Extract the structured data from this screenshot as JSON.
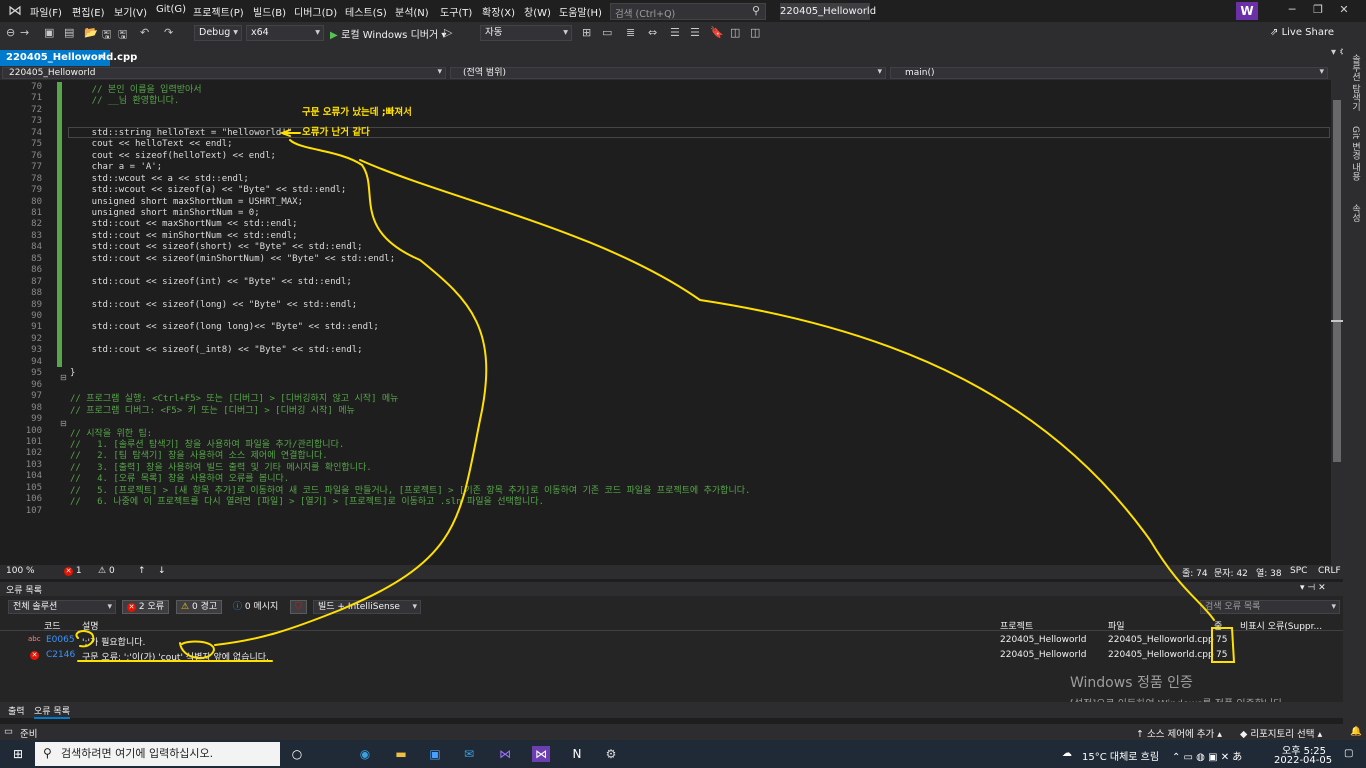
{
  "menu": [
    "파일(F)",
    "편집(E)",
    "보기(V)",
    "Git(G)",
    "프로젝트(P)",
    "빌드(B)",
    "디버그(D)",
    "테스트(S)",
    "분석(N)",
    "도구(T)",
    "확장(X)",
    "창(W)",
    "도움말(H)"
  ],
  "search": {
    "placeholder": "검색 (Ctrl+Q)"
  },
  "solution_name": "220405_Helloworld",
  "user_initial": "W",
  "toolbar": {
    "config": "Debug",
    "platform": "x64",
    "run_label": "로컬 Windows 디버거",
    "mode": "자동",
    "live_share": "Live Share"
  },
  "doc_tab": {
    "name": "220405_Helloworld.cpp",
    "close": "×"
  },
  "navbar": {
    "project": "220405_Helloworld",
    "scope": "(전역 범위)",
    "function": "main()"
  },
  "right_strip": [
    "솔루션 탐색기",
    "Git 변경 내용",
    "속성"
  ],
  "code": [
    {
      "n": "70",
      "t": "    // 본인 이름을 입력받아서",
      "k": "com"
    },
    {
      "n": "71",
      "t": "    // __님 환영합니다.",
      "k": "com"
    },
    {
      "n": "72",
      "t": "",
      "k": "txt"
    },
    {
      "n": "73",
      "t": "",
      "k": "txt"
    },
    {
      "n": "74",
      "t": "    std::string helloText = \"helloworld!\"",
      "k": "txt"
    },
    {
      "n": "75",
      "t": "    cout << helloText << endl;",
      "k": "txt"
    },
    {
      "n": "76",
      "t": "    cout << sizeof(helloText) << endl;",
      "k": "txt"
    },
    {
      "n": "77",
      "t": "    char a = 'A';",
      "k": "txt"
    },
    {
      "n": "78",
      "t": "    std::wcout << a << std::endl;",
      "k": "txt"
    },
    {
      "n": "79",
      "t": "    std::wcout << sizeof(a) << \"Byte\" << std::endl;",
      "k": "txt"
    },
    {
      "n": "80",
      "t": "    unsigned short maxShortNum = USHRT_MAX;",
      "k": "txt"
    },
    {
      "n": "81",
      "t": "    unsigned short minShortNum = 0;",
      "k": "txt"
    },
    {
      "n": "82",
      "t": "    std::cout << maxShortNum << std::endl;",
      "k": "txt"
    },
    {
      "n": "83",
      "t": "    std::cout << minShortNum << std::endl;",
      "k": "txt"
    },
    {
      "n": "84",
      "t": "    std::cout << sizeof(short) << \"Byte\" << std::endl;",
      "k": "txt"
    },
    {
      "n": "85",
      "t": "    std::cout << sizeof(minShortNum) << \"Byte\" << std::endl;",
      "k": "txt"
    },
    {
      "n": "86",
      "t": "",
      "k": "txt"
    },
    {
      "n": "87",
      "t": "    std::cout << sizeof(int) << \"Byte\" << std::endl;",
      "k": "txt"
    },
    {
      "n": "88",
      "t": "",
      "k": "txt"
    },
    {
      "n": "89",
      "t": "    std::cout << sizeof(long) << \"Byte\" << std::endl;",
      "k": "txt"
    },
    {
      "n": "90",
      "t": "",
      "k": "txt"
    },
    {
      "n": "91",
      "t": "    std::cout << sizeof(long long)<< \"Byte\" << std::endl;",
      "k": "txt"
    },
    {
      "n": "92",
      "t": "",
      "k": "txt"
    },
    {
      "n": "93",
      "t": "    std::cout << sizeof(_int8) << \"Byte\" << std::endl;",
      "k": "txt"
    },
    {
      "n": "94",
      "t": "",
      "k": "txt"
    },
    {
      "n": "95",
      "t": "}",
      "k": "txt"
    },
    {
      "n": "96",
      "t": "",
      "k": "txt"
    },
    {
      "n": "97",
      "t": "// 프로그램 실행: <Ctrl+F5> 또는 [디버그] > [디버깅하지 않고 시작] 메뉴",
      "k": "com"
    },
    {
      "n": "98",
      "t": "// 프로그램 디버그: <F5> 키 또는 [디버그] > [디버깅 시작] 메뉴",
      "k": "com"
    },
    {
      "n": "99",
      "t": "",
      "k": "txt"
    },
    {
      "n": "100",
      "t": "// 시작을 위한 팁:",
      "k": "com"
    },
    {
      "n": "101",
      "t": "//   1. [솔루션 탐색기] 창을 사용하여 파일을 추가/관리합니다.",
      "k": "com"
    },
    {
      "n": "102",
      "t": "//   2. [팀 탐색기] 창을 사용하여 소스 제어에 연결합니다.",
      "k": "com"
    },
    {
      "n": "103",
      "t": "//   3. [출력] 창을 사용하여 빌드 출력 및 기타 메시지를 확인합니다.",
      "k": "com"
    },
    {
      "n": "104",
      "t": "//   4. [오류 목록] 창을 사용하여 오류를 봅니다.",
      "k": "com"
    },
    {
      "n": "105",
      "t": "//   5. [프로젝트] > [새 항목 추가]로 이동하여 새 코드 파일을 만들거나, [프로젝트] > [기존 항목 추가]로 이동하여 기존 코드 파일을 프로젝트에 추가합니다.",
      "k": "com"
    },
    {
      "n": "106",
      "t": "//   6. 나중에 이 프로젝트를 다시 열려면 [파일] > [열기] > [프로젝트]로 이동하고 .sln 파일을 선택합니다.",
      "k": "com"
    },
    {
      "n": "107",
      "t": "",
      "k": "txt"
    }
  ],
  "editor_status": {
    "zoom": "100 %",
    "errors": "1",
    "warnings": "0",
    "line": "줄: 74",
    "char": "문자: 42",
    "col": "열: 38",
    "spc": "SPC",
    "crlf": "CRLF"
  },
  "error_list": {
    "title": "오류 목록",
    "scope": "전체 솔루션",
    "errors_btn": "2 오류",
    "warnings_btn": "0 경고",
    "messages_btn": "0 메시지",
    "build_filter": "빌드 + IntelliSense",
    "search_placeholder": "검색 오류 목록",
    "headers": {
      "code": "코드",
      "desc": "설명",
      "project": "프로젝트",
      "file": "파일",
      "line": "줄",
      "suppress": "비표시 오류(Suppr..."
    },
    "rows": [
      {
        "icon": "abc",
        "code": "E0065",
        "desc": "';'가 필요합니다.",
        "project": "220405_Helloworld",
        "file": "220405_Helloworld.cpp",
        "line": "75"
      },
      {
        "icon": "x",
        "code": "C2146",
        "desc": "구문 오류: ';'이(가) 'cout' 식별자 앞에 없습니다.",
        "project": "220405_Helloworld",
        "file": "220405_Helloworld.cpp",
        "line": "75"
      }
    ]
  },
  "activation": {
    "title": "Windows 정품 인증",
    "subtitle": "[설정]으로 이동하여 Windows를 정품 인증합니다."
  },
  "bottom_tabs": [
    "출력",
    "오류 목록"
  ],
  "statusbar": {
    "ready": "준비",
    "source_control": "소스 제어에 추가",
    "repo": "리포지토리 선택"
  },
  "taskbar": {
    "search_placeholder": "검색하려면 여기에 입력하십시오.",
    "weather": "15°C 대체로 흐림",
    "time": "오후 5:25",
    "date": "2022-04-05"
  },
  "annotation": {
    "line1": "구문 오류가 났는데 ;빠져서",
    "line2": "오류가 난거 같다"
  },
  "colors": {
    "accent": "#007acc",
    "annotation": "#ffe000",
    "error": "#e51400",
    "comment": "#57a64a"
  }
}
